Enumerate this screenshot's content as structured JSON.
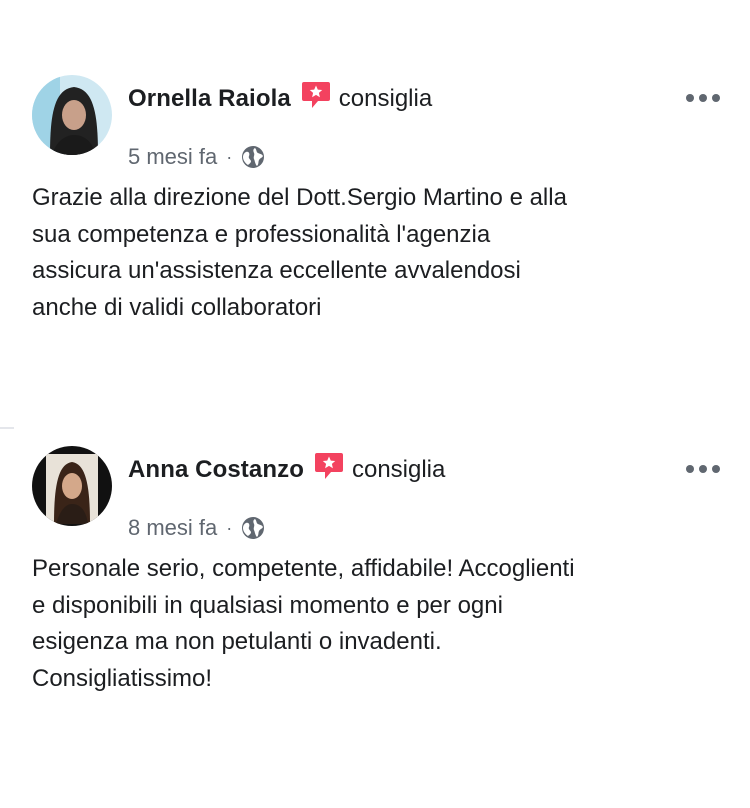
{
  "reviews": [
    {
      "author": "Ornella Raiola",
      "action": "consiglia",
      "time": "5 mesi fa",
      "separator": "·",
      "text": "Grazie alla direzione del Dott.Sergio Martino e alla\nsua competenza e professionalità l'agenzia\nassicura un'assistenza eccellente avvalendosi\nanche di validi collaboratori",
      "icons": {
        "recommend": "recommend-star-icon",
        "privacy": "globe-icon",
        "menu": "more-options-icon"
      }
    },
    {
      "author": "Anna Costanzo",
      "action": "consiglia",
      "time": "8 mesi fa",
      "separator": "·",
      "text": "Personale serio, competente, affidabile! Accoglienti\ne disponibili in qualsiasi momento e per ogni\nesigenza ma non petulanti o invadenti.\nConsigliatissimo!",
      "icons": {
        "recommend": "recommend-star-icon",
        "privacy": "globe-icon",
        "menu": "more-options-icon"
      }
    }
  ],
  "colors": {
    "recommend_accent": "#f3425f",
    "text_primary": "#1c1e21",
    "text_secondary": "#606770"
  }
}
